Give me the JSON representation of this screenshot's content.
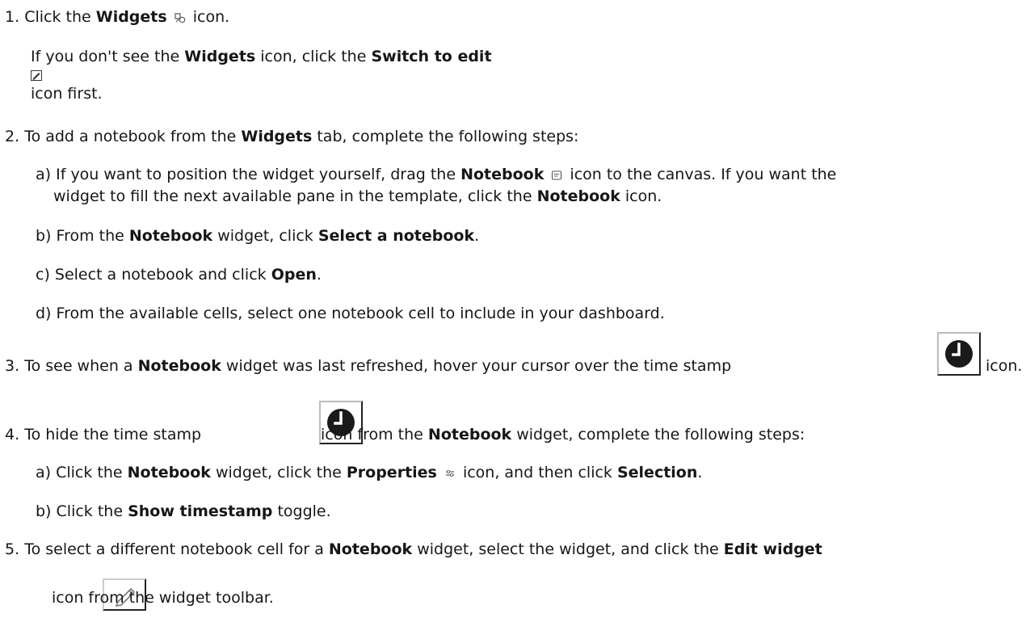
{
  "step1": {
    "num": "1.",
    "t1": "Click the ",
    "b1": "Widgets",
    "t2": " icon.",
    "note_t1": "If you don't see the ",
    "note_b1": "Widgets",
    "note_t2": " icon, click the ",
    "note_b2": "Switch to edit",
    "note_t3": "icon first."
  },
  "step2": {
    "num": "2.",
    "t1": "To add a notebook from the ",
    "b1": "Widgets",
    "t2": " tab, complete the following steps:",
    "a_label": "a)",
    "a_t1": "If you want to position the widget yourself, drag the ",
    "a_b1": "Notebook",
    "a_t2": " icon to the canvas. If you want the",
    "a_line2_t1": "widget to fill the next available pane in the template, click the ",
    "a_line2_b1": "Notebook",
    "a_line2_t2": " icon.",
    "b_label": "b)",
    "b_t1": "From the ",
    "b_b1": "Notebook",
    "b_t2": " widget, click ",
    "b_b2": "Select a notebook",
    "b_t3": ".",
    "c_label": "c)",
    "c_t1": "Select a notebook and click ",
    "c_b1": "Open",
    "c_t2": ".",
    "d_label": "d)",
    "d_t1": "From the available cells, select one notebook cell to include in your dashboard."
  },
  "step3": {
    "num": "3.",
    "t1": "To see when a ",
    "b1": "Notebook",
    "t2": " widget was last refreshed, hover your cursor over the time stamp",
    "t3": "icon."
  },
  "step4": {
    "num": "4.",
    "t1": "To hide the time stamp",
    "t2": "icon from the ",
    "b1": "Notebook",
    "t3": " widget, complete the following steps:",
    "a_label": "a)",
    "a_t1": "Click the ",
    "a_b1": "Notebook",
    "a_t2": " widget, click the ",
    "a_b2": "Properties",
    "a_t3": " icon, and then click ",
    "a_b3": "Selection",
    "a_t4": ".",
    "b_label": "b)",
    "b_t1": "Click the ",
    "b_b1": "Show timestamp",
    "b_t2": " toggle."
  },
  "step5": {
    "num": "5.",
    "t1": "To select a different notebook cell for a ",
    "b1": "Notebook",
    "t2": " widget, select the widget, and click the ",
    "b2": "Edit widget",
    "t3": "icon from the widget toolbar."
  }
}
